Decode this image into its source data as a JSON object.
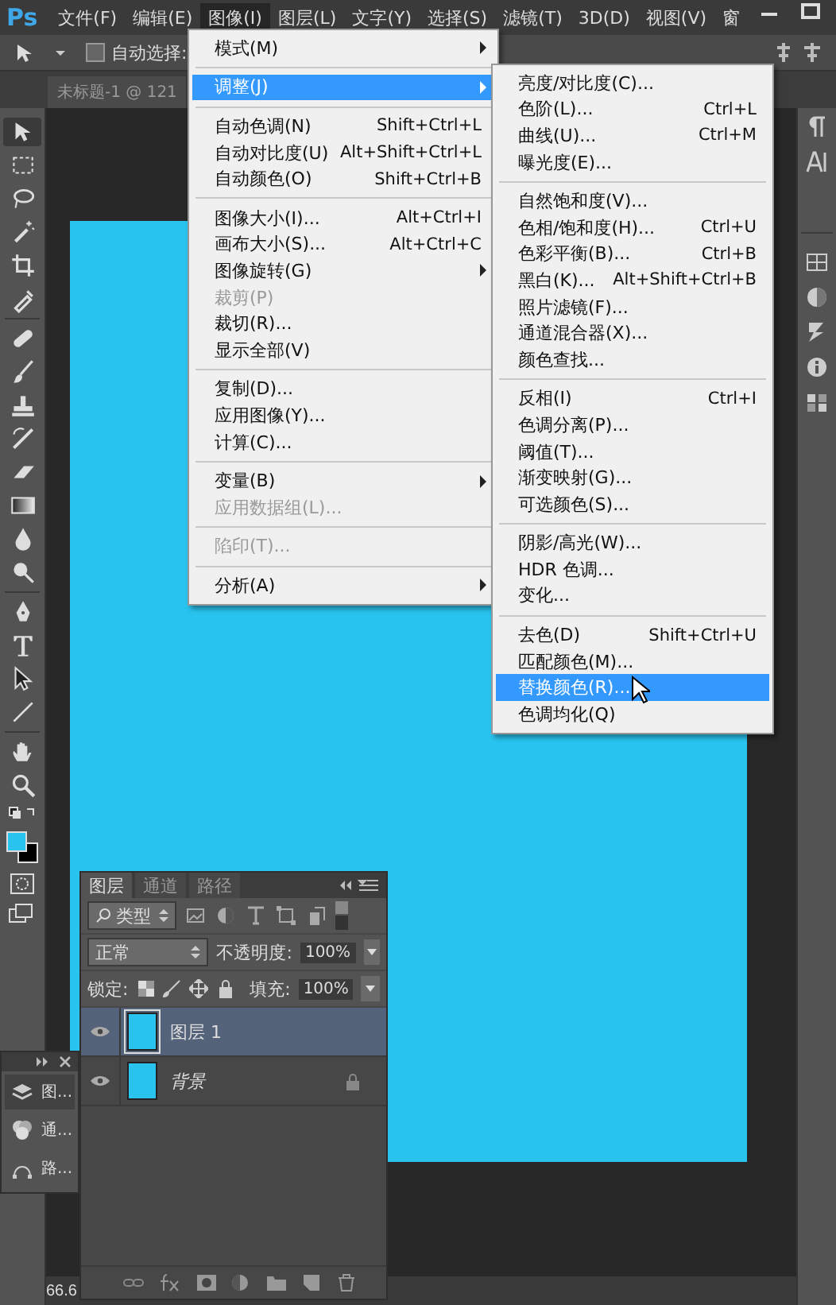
{
  "app_logo": "Ps",
  "menu_bar": {
    "items": [
      {
        "label": "文件(F)",
        "selected": false
      },
      {
        "label": "编辑(E)",
        "selected": false
      },
      {
        "label": "图像(I)",
        "selected": true
      },
      {
        "label": "图层(L)",
        "selected": false
      },
      {
        "label": "文字(Y)",
        "selected": false
      },
      {
        "label": "选择(S)",
        "selected": false
      },
      {
        "label": "滤镜(T)",
        "selected": false
      },
      {
        "label": "3D(D)",
        "selected": false
      },
      {
        "label": "视图(V)",
        "selected": false
      },
      {
        "label": "窗",
        "selected": false
      }
    ]
  },
  "options_bar": {
    "auto_select": {
      "label": "自动选择:",
      "checked": false
    }
  },
  "document_tab": {
    "title": "未标题-1 @ 121"
  },
  "tools": [
    {
      "kind": "move",
      "selected": true
    },
    {
      "kind": "marquee",
      "selected": false
    },
    {
      "kind": "lasso",
      "selected": false
    },
    {
      "kind": "wand",
      "selected": false
    },
    {
      "kind": "crop",
      "selected": false
    },
    {
      "kind": "eyedropper",
      "selected": false
    },
    {
      "kind": "bandage",
      "selected": false
    },
    {
      "kind": "brush",
      "selected": false
    },
    {
      "kind": "stamp",
      "selected": false
    },
    {
      "kind": "historybrush",
      "selected": false
    },
    {
      "kind": "eraser",
      "selected": false
    },
    {
      "kind": "gradient",
      "selected": false
    },
    {
      "kind": "drop",
      "selected": false
    },
    {
      "kind": "dodge",
      "selected": false
    },
    {
      "kind": "pen",
      "selected": false
    },
    {
      "kind": "type",
      "selected": false
    },
    {
      "kind": "arrow",
      "selected": false
    },
    {
      "kind": "line",
      "selected": false
    },
    {
      "kind": "hand",
      "selected": false
    },
    {
      "kind": "zoom",
      "selected": false
    }
  ],
  "image_menu": {
    "groups": [
      [
        {
          "label": "模式(M)",
          "submenu": true,
          "selected": false,
          "disabled": false
        }
      ],
      [
        {
          "label": "调整(J)",
          "submenu": true,
          "selected": true,
          "disabled": false
        }
      ],
      [
        {
          "label": "自动色调(N)",
          "shortcut": "Shift+Ctrl+L",
          "submenu": false,
          "selected": false,
          "disabled": false
        },
        {
          "label": "自动对比度(U)",
          "shortcut": "Alt+Shift+Ctrl+L",
          "submenu": false,
          "selected": false,
          "disabled": false
        },
        {
          "label": "自动颜色(O)",
          "shortcut": "Shift+Ctrl+B",
          "submenu": false,
          "selected": false,
          "disabled": false
        }
      ],
      [
        {
          "label": "图像大小(I)...",
          "shortcut": "Alt+Ctrl+I",
          "submenu": false,
          "selected": false,
          "disabled": false
        },
        {
          "label": "画布大小(S)...",
          "shortcut": "Alt+Ctrl+C",
          "submenu": false,
          "selected": false,
          "disabled": false
        },
        {
          "label": "图像旋转(G)",
          "submenu": true,
          "selected": false,
          "disabled": false
        },
        {
          "label": "裁剪(P)",
          "submenu": false,
          "selected": false,
          "disabled": true
        },
        {
          "label": "裁切(R)...",
          "submenu": false,
          "selected": false,
          "disabled": false
        },
        {
          "label": "显示全部(V)",
          "submenu": false,
          "selected": false,
          "disabled": false
        }
      ],
      [
        {
          "label": "复制(D)...",
          "submenu": false,
          "selected": false,
          "disabled": false
        },
        {
          "label": "应用图像(Y)...",
          "submenu": false,
          "selected": false,
          "disabled": false
        },
        {
          "label": "计算(C)...",
          "submenu": false,
          "selected": false,
          "disabled": false
        }
      ],
      [
        {
          "label": "变量(B)",
          "submenu": true,
          "selected": false,
          "disabled": false
        },
        {
          "label": "应用数据组(L)...",
          "submenu": false,
          "selected": false,
          "disabled": true
        }
      ],
      [
        {
          "label": "陷印(T)...",
          "submenu": false,
          "selected": false,
          "disabled": true
        }
      ],
      [
        {
          "label": "分析(A)",
          "submenu": true,
          "selected": false,
          "disabled": false
        }
      ]
    ]
  },
  "adjust_menu": {
    "groups": [
      [
        {
          "label": "亮度/对比度(C)...",
          "selected": false
        },
        {
          "label": "色阶(L)...",
          "shortcut": "Ctrl+L",
          "selected": false
        },
        {
          "label": "曲线(U)...",
          "shortcut": "Ctrl+M",
          "selected": false
        },
        {
          "label": "曝光度(E)...",
          "selected": false
        }
      ],
      [
        {
          "label": "自然饱和度(V)...",
          "selected": false
        },
        {
          "label": "色相/饱和度(H)...",
          "shortcut": "Ctrl+U",
          "selected": false
        },
        {
          "label": "色彩平衡(B)...",
          "shortcut": "Ctrl+B",
          "selected": false
        },
        {
          "label": "黑白(K)...",
          "shortcut": "Alt+Shift+Ctrl+B",
          "selected": false
        },
        {
          "label": "照片滤镜(F)...",
          "selected": false
        },
        {
          "label": "通道混合器(X)...",
          "selected": false
        },
        {
          "label": "颜色查找...",
          "selected": false
        }
      ],
      [
        {
          "label": "反相(I)",
          "shortcut": "Ctrl+I",
          "selected": false
        },
        {
          "label": "色调分离(P)...",
          "selected": false
        },
        {
          "label": "阈值(T)...",
          "selected": false
        },
        {
          "label": "渐变映射(G)...",
          "selected": false
        },
        {
          "label": "可选颜色(S)...",
          "selected": false
        }
      ],
      [
        {
          "label": "阴影/高光(W)...",
          "selected": false
        },
        {
          "label": "HDR 色调...",
          "selected": false
        },
        {
          "label": "变化...",
          "selected": false
        }
      ],
      [
        {
          "label": "去色(D)",
          "shortcut": "Shift+Ctrl+U",
          "selected": false
        },
        {
          "label": "匹配颜色(M)...",
          "selected": false
        },
        {
          "label": "替换颜色(R)...",
          "selected": true
        },
        {
          "label": "色调均化(Q)",
          "selected": false
        }
      ]
    ]
  },
  "mini_panel": {
    "items": [
      {
        "kind": "layers",
        "label": "图...",
        "selected": true
      },
      {
        "kind": "channels",
        "label": "通...",
        "selected": false
      },
      {
        "kind": "paths",
        "label": "路...",
        "selected": false
      }
    ]
  },
  "layers_panel": {
    "tabs": [
      {
        "label": "图层",
        "selected": true
      },
      {
        "label": "通道",
        "selected": false
      },
      {
        "label": "路径",
        "selected": false
      }
    ],
    "filter": "类型",
    "blend_mode": "正常",
    "opacity_label": "不透明度:",
    "opacity": "100%",
    "lock_label": "锁定:",
    "fill_label": "填充:",
    "fill": "100%",
    "layers": [
      {
        "kind": "layer",
        "name": "图层 1",
        "selected": true,
        "visible": true,
        "locked": false
      },
      {
        "kind": "background",
        "name": "背景",
        "selected": false,
        "visible": true,
        "locked": true
      }
    ]
  },
  "status_bar": {
    "zoom": "66.6"
  }
}
